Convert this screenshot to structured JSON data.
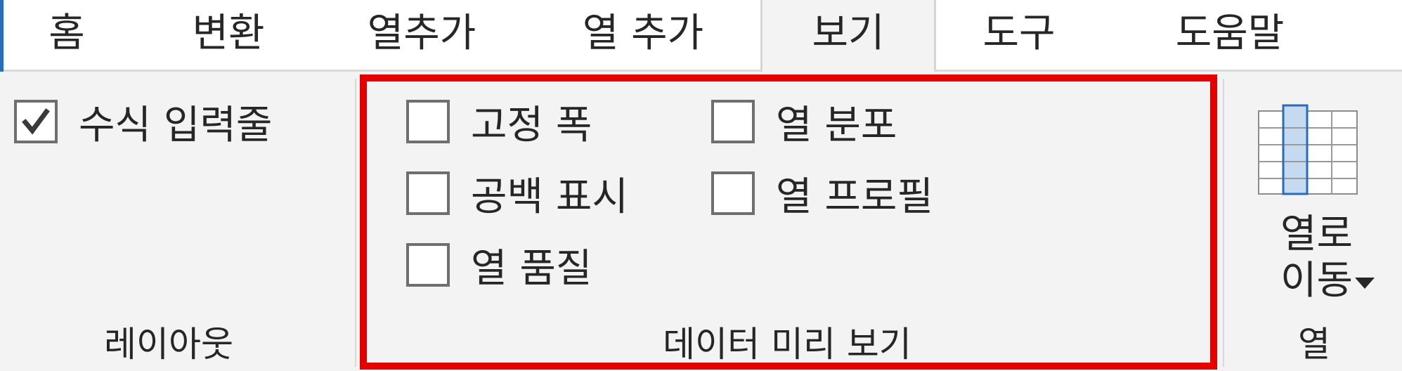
{
  "tabs": [
    {
      "label": "홈"
    },
    {
      "label": "변환"
    },
    {
      "label": "열추가"
    },
    {
      "label": "열 추가"
    },
    {
      "label": "보기"
    },
    {
      "label": "도구"
    },
    {
      "label": "도움말"
    }
  ],
  "selected_tab": "보기",
  "layout_group": {
    "formula_bar": {
      "label": "수식 입력줄",
      "checked": true
    },
    "group_label": "레이아웃"
  },
  "preview_group": {
    "items": [
      {
        "label": "고정 폭",
        "checked": false
      },
      {
        "label": "열 분포",
        "checked": false
      },
      {
        "label": "공백 표시",
        "checked": false
      },
      {
        "label": "열 프로필",
        "checked": false
      },
      {
        "label": "열 품질",
        "checked": false
      }
    ],
    "group_label": "데이터 미리 보기"
  },
  "columns_group": {
    "move_button_line1": "열로",
    "move_button_line2": "이동",
    "group_label": "열",
    "icon": "column-grid-icon"
  },
  "colors": {
    "accent": "#2b6cb8",
    "highlight": "#e50000",
    "grid_selected": "#c5daf0",
    "grid_selected_border": "#2b6cb8"
  }
}
